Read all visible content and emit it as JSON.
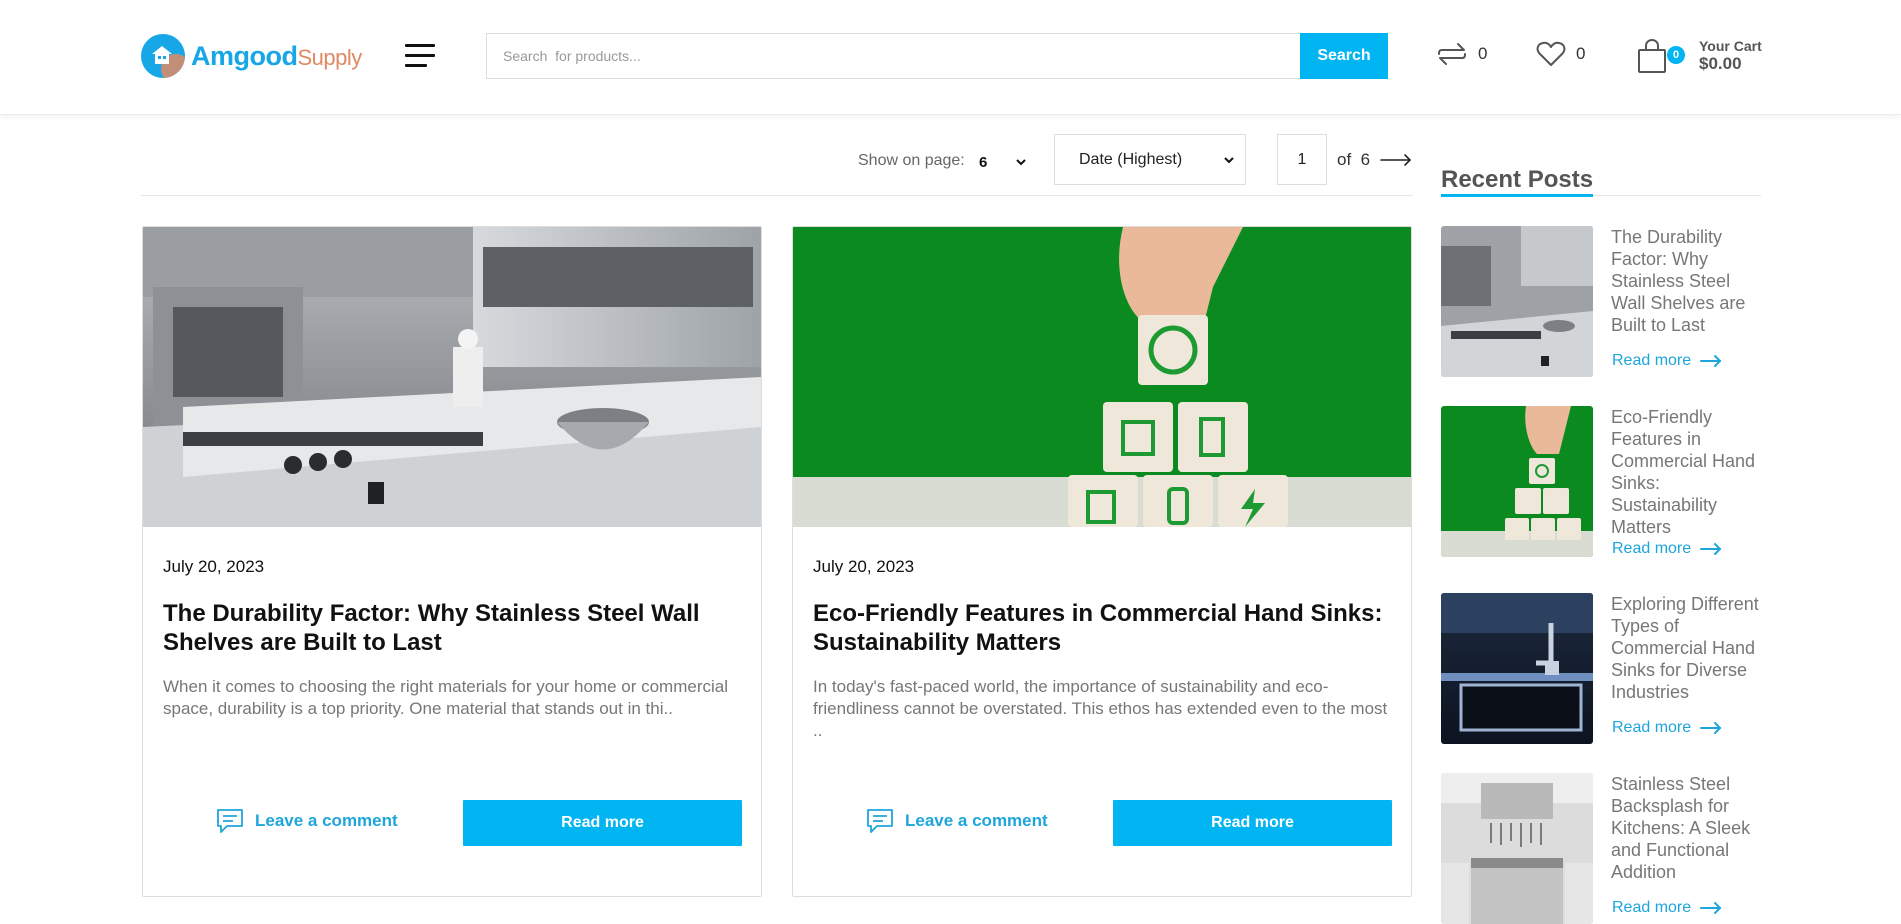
{
  "header": {
    "logo_brand": "Amgood",
    "logo_suffix": "Supply",
    "search_placeholder": "Search  for products...",
    "search_button": "Search",
    "compare_count": "0",
    "wishlist_count": "0",
    "cart_count": "0",
    "cart_label": "Your Cart",
    "cart_total": "$0.00"
  },
  "toolbar": {
    "show_label": "Show on page:",
    "show_value": "6",
    "sort_value": "Date (Highest)",
    "page_current": "1",
    "page_of": "of",
    "page_total": "6"
  },
  "posts": [
    {
      "date": "July 20, 2023",
      "title": "The Durability Factor: Why Stainless Steel Wall Shelves are Built to Last",
      "excerpt": "When it comes to choosing the right materials for your home or commercial space, durability is a top priority. One material that stands out in thi..",
      "comment_label": "Leave a comment",
      "read_more": "Read more"
    },
    {
      "date": "July 20, 2023",
      "title": "Eco-Friendly Features in Commercial Hand Sinks: Sustainability Matters",
      "excerpt": "In today's fast-paced world, the importance of sustainability and eco-friendliness cannot be overstated. This ethos has extended even to the most ..",
      "comment_label": "Leave a comment",
      "read_more": "Read more"
    }
  ],
  "sidebar": {
    "title": "Recent Posts",
    "items": [
      {
        "title": "The Durability Factor: Why Stainless Steel Wall Shelves are Built to Last",
        "read_more": "Read more"
      },
      {
        "title": "Eco-Friendly Features in Commercial Hand Sinks: Sustainability Matters",
        "read_more": "Read more"
      },
      {
        "title": "Exploring Different Types of Commercial Hand Sinks for Diverse Industries",
        "read_more": "Read more"
      },
      {
        "title": "Stainless Steel Backsplash for Kitchens: A Sleek and Functional Addition",
        "read_more": "Read more"
      }
    ]
  },
  "colors": {
    "accent": "#00b5f2",
    "link": "#1ea5dc",
    "brand_orange": "#e08a63",
    "green_bg": "#0a8a1f"
  }
}
